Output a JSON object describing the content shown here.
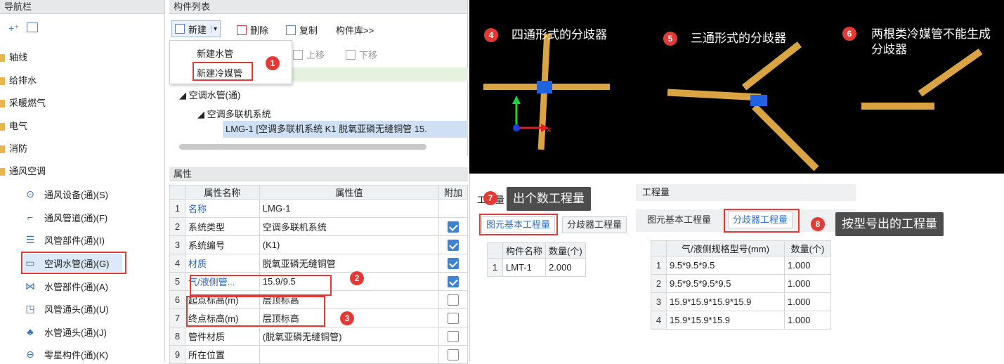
{
  "nav": {
    "title": "导航栏",
    "items": [
      "轴线",
      "给排水",
      "采暖燃气",
      "电气",
      "消防",
      "通风空调"
    ],
    "sub": [
      "通风设备(通)(S)",
      "通风管道(通)(F)",
      "风管部件(通)(I)",
      "空调水管(通)(G)",
      "水管部件(通)(A)",
      "风管通头(通)(U)",
      "水管通头(通)(J)",
      "零星构件(通)(K)"
    ]
  },
  "comp": {
    "title": "构件列表",
    "new": "新建",
    "delete": "删除",
    "copy": "复制",
    "library": "构件库>>",
    "up": "上移",
    "down": "下移",
    "menu": [
      "新建水管",
      "新建冷媒管"
    ],
    "tree": [
      "空调水管(通)",
      "空调多联机系统",
      "LMG-1 [空调多联机系统 K1 脱氧亚磷无缝铜管 15."
    ]
  },
  "attr": {
    "title": "属性",
    "headers": [
      "属性名称",
      "属性值",
      "附加"
    ],
    "rows": [
      {
        "n": "1",
        "name": "名称",
        "val": "LMG-1",
        "check": "none"
      },
      {
        "n": "2",
        "name": "系统类型",
        "val": "空调多联机系统",
        "check": "on"
      },
      {
        "n": "3",
        "name": "系统编号",
        "val": "(K1)",
        "check": "on"
      },
      {
        "n": "4",
        "name": "材质",
        "val": "脱氧亚磷无缝铜管",
        "check": "on"
      },
      {
        "n": "5",
        "name": "气/液侧管...",
        "val": "15.9/9.5",
        "check": "on"
      },
      {
        "n": "6",
        "name": "起点标高(m)",
        "val": "层顶标高",
        "check": "off"
      },
      {
        "n": "7",
        "name": "终点标高(m)",
        "val": "层顶标高",
        "check": "off"
      },
      {
        "n": "8",
        "name": "管件材质",
        "val": "(脱氧亚磷无缝铜管)",
        "check": "off"
      },
      {
        "n": "9",
        "name": "所在位置",
        "val": "",
        "check": "off"
      }
    ]
  },
  "view": {
    "n4": "4",
    "t4": "四通形式的分歧器",
    "n5": "5",
    "t5": "三通形式的分歧器",
    "n6": "6",
    "t6": "两根类冷媒管不能生成分歧器"
  },
  "qty1": {
    "title": "工程量",
    "tab1": "图元基本工程量",
    "tab2": "分歧器工程量",
    "tip": "出个数工程量",
    "headers": [
      "构件名称",
      "数量(个)"
    ],
    "rows": [
      [
        "1",
        "LMT-1",
        "2.000"
      ]
    ]
  },
  "qty2": {
    "title": "工程量",
    "tab1": "图元基本工程量",
    "tab2": "分歧器工程量",
    "tip": "按型号出的工程量",
    "headers": [
      "气/液侧规格型号(mm)",
      "数量(个)"
    ],
    "rows": [
      [
        "1",
        "9.5*9.5*9.5",
        "1.000"
      ],
      [
        "2",
        "9.5*9.5*9.5*9.5",
        "1.000"
      ],
      [
        "3",
        "15.9*15.9*15.9*15.9",
        "1.000"
      ],
      [
        "4",
        "15.9*15.9*15.9",
        "1.000"
      ]
    ]
  },
  "badges": [
    "1",
    "2",
    "3",
    "7",
    "8"
  ]
}
